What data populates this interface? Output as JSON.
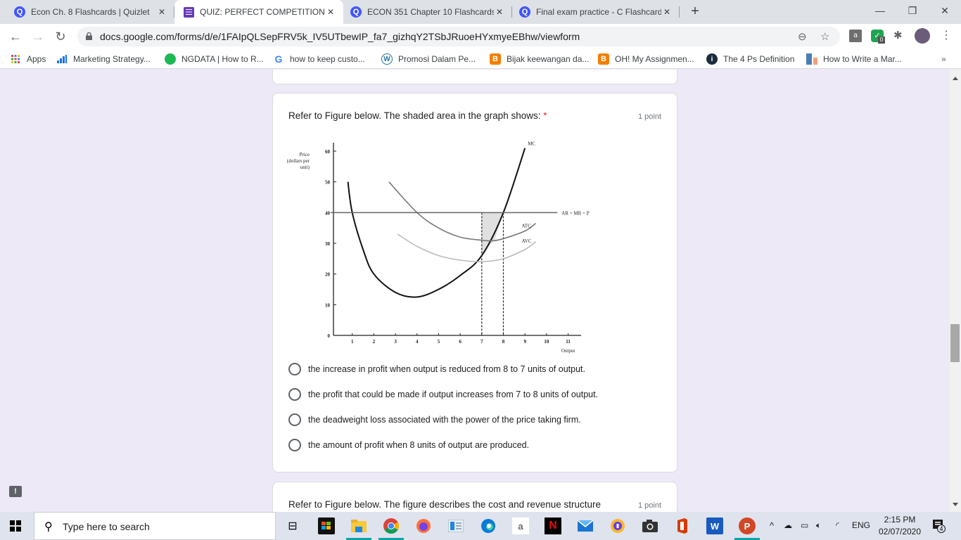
{
  "browser": {
    "tabs": [
      {
        "label": "Econ Ch. 8 Flashcards | Quizlet",
        "icon": "quizlet-icon",
        "active": false
      },
      {
        "label": "QUIZ: PERFECT COMPETITION",
        "icon": "google-forms-icon",
        "active": true
      },
      {
        "label": "ECON 351 Chapter 10 Flashcards",
        "icon": "quizlet-icon",
        "active": false
      },
      {
        "label": "Final exam practice - C Flashcards",
        "icon": "quizlet-icon",
        "active": false
      }
    ],
    "new_tab": "+",
    "window_controls": {
      "minimize": "—",
      "restore": "❐",
      "close": "✕"
    },
    "url": "docs.google.com/forms/d/e/1FAIpQLSepFRV5k_IV5UTbewIP_fa7_gizhqY2TSbJRuoeHYxmyeEBhw/viewform",
    "extension_badge": "0",
    "bookmarks": [
      {
        "label": "Apps",
        "icon": "apps-grid-icon"
      },
      {
        "label": "Marketing Strategy...",
        "icon": "bar-chart-icon"
      },
      {
        "label": "NGDATA | How to R...",
        "icon": "ngdata-icon"
      },
      {
        "label": "how to keep custo...",
        "icon": "google-icon"
      },
      {
        "label": "Promosi Dalam Pe...",
        "icon": "wordpress-icon"
      },
      {
        "label": "Bijak keewangan da...",
        "icon": "blogger-icon"
      },
      {
        "label": "OH! My Assignmen...",
        "icon": "blogger-icon"
      },
      {
        "label": "The 4 Ps Definition",
        "icon": "investopedia-icon"
      },
      {
        "label": "How to Write a Mar...",
        "icon": "bookmark-page-icon"
      }
    ],
    "bookmarks_overflow": "»"
  },
  "form": {
    "question1": {
      "title": "Refer to Figure below. The shaded area in the graph shows:",
      "required_mark": "*",
      "points": "1 point",
      "options": [
        "the increase in profit when output is reduced from 8 to 7 units of output.",
        "the profit that could be made if output increases from 7 to 8 units of output.",
        "the deadweight loss associated with the power of the price taking firm.",
        "the amount of profit when 8 units of output are produced."
      ]
    },
    "question2": {
      "title": "Refer to Figure below. The figure describes the cost and revenue structure",
      "points": "1 point"
    }
  },
  "chart_data": {
    "type": "line",
    "title": "",
    "ylabel": "Price (dollars per unit)",
    "xlabel": "Output",
    "xlim": [
      0,
      11.5
    ],
    "ylim": [
      0,
      62
    ],
    "x_ticks": [
      1,
      2,
      3,
      4,
      5,
      6,
      7,
      8,
      9,
      10,
      11
    ],
    "y_ticks": [
      0,
      10,
      20,
      30,
      40,
      50,
      60
    ],
    "series": [
      {
        "name": "MC",
        "x": [
          0.8,
          1,
          1.5,
          2,
          3,
          4,
          5,
          6,
          7,
          8,
          9
        ],
        "y": [
          50,
          40,
          28,
          20,
          14,
          12.5,
          15,
          19.5,
          26,
          40,
          61
        ]
      },
      {
        "name": "ATC",
        "x": [
          2.7,
          4,
          5,
          6,
          7,
          7.5,
          8,
          9,
          9.5
        ],
        "y": [
          50,
          40,
          35,
          32,
          31,
          30.8,
          31.5,
          34,
          36.5
        ]
      },
      {
        "name": "AVC",
        "x": [
          3.1,
          4,
          5,
          6,
          7,
          8,
          9,
          9.5
        ],
        "y": [
          33,
          29,
          26,
          24.5,
          24,
          25,
          28,
          30.5
        ]
      },
      {
        "name": "AR = MR = P",
        "x": [
          0,
          10.5
        ],
        "y": [
          40,
          40
        ]
      }
    ],
    "reference_lines": [
      {
        "x": 7,
        "from_y": 0,
        "to_y": 40,
        "style": "dashed"
      },
      {
        "x": 8,
        "from_y": 0,
        "to_y": 40,
        "style": "dashed"
      }
    ],
    "shaded_region": {
      "description": "area between P=40 and MC from output 7 to 8",
      "x_range": [
        7,
        8
      ]
    },
    "origin_label": "0"
  },
  "taskbar": {
    "search_placeholder": "Type here to search",
    "time": "2:15 PM",
    "date": "02/07/2020",
    "language": "ENG",
    "notification_count": "4"
  },
  "feedback_icon": "!"
}
